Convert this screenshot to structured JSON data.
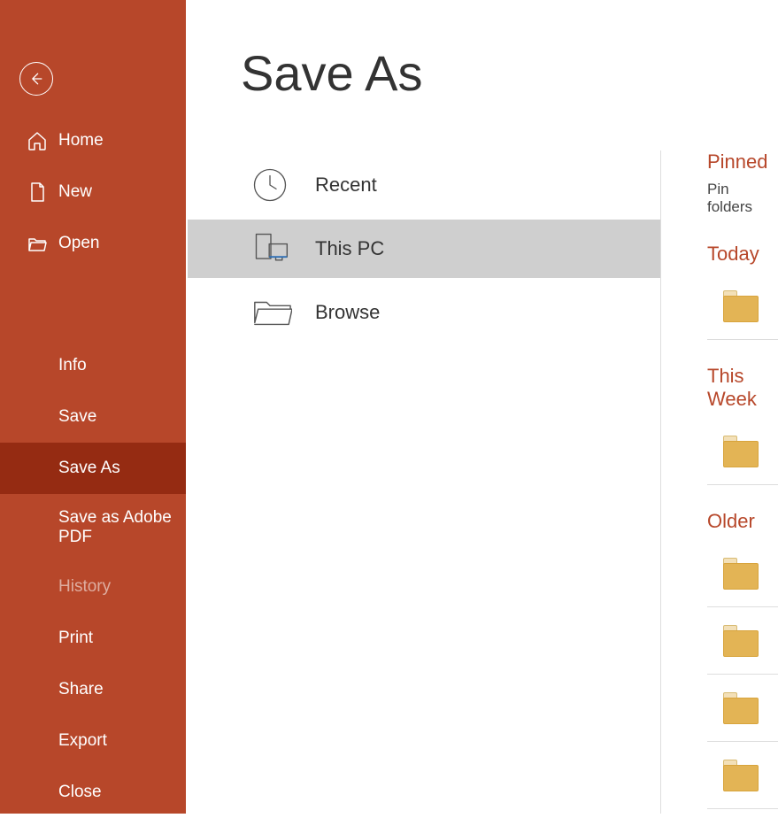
{
  "page_title": "Save As",
  "sidebar": {
    "top": [
      {
        "label": "Home",
        "icon": "home"
      },
      {
        "label": "New",
        "icon": "new"
      },
      {
        "label": "Open",
        "icon": "open"
      }
    ],
    "items": [
      {
        "label": "Info"
      },
      {
        "label": "Save"
      },
      {
        "label": "Save As",
        "selected": true
      },
      {
        "label": "Save as Adobe PDF"
      },
      {
        "label": "History",
        "disabled": true
      },
      {
        "label": "Print"
      },
      {
        "label": "Share"
      },
      {
        "label": "Export"
      },
      {
        "label": "Close"
      }
    ]
  },
  "locations": [
    {
      "label": "Recent",
      "icon": "clock"
    },
    {
      "label": "This PC",
      "icon": "thispc",
      "selected": true
    },
    {
      "label": "Browse",
      "icon": "browse"
    }
  ],
  "right": {
    "pinned_header": "Pinned",
    "pin_hint": "Pin folders",
    "groups": [
      {
        "header": "Today",
        "count": 1
      },
      {
        "header": "This Week",
        "count": 1
      },
      {
        "header": "Older",
        "count": 4
      }
    ]
  }
}
